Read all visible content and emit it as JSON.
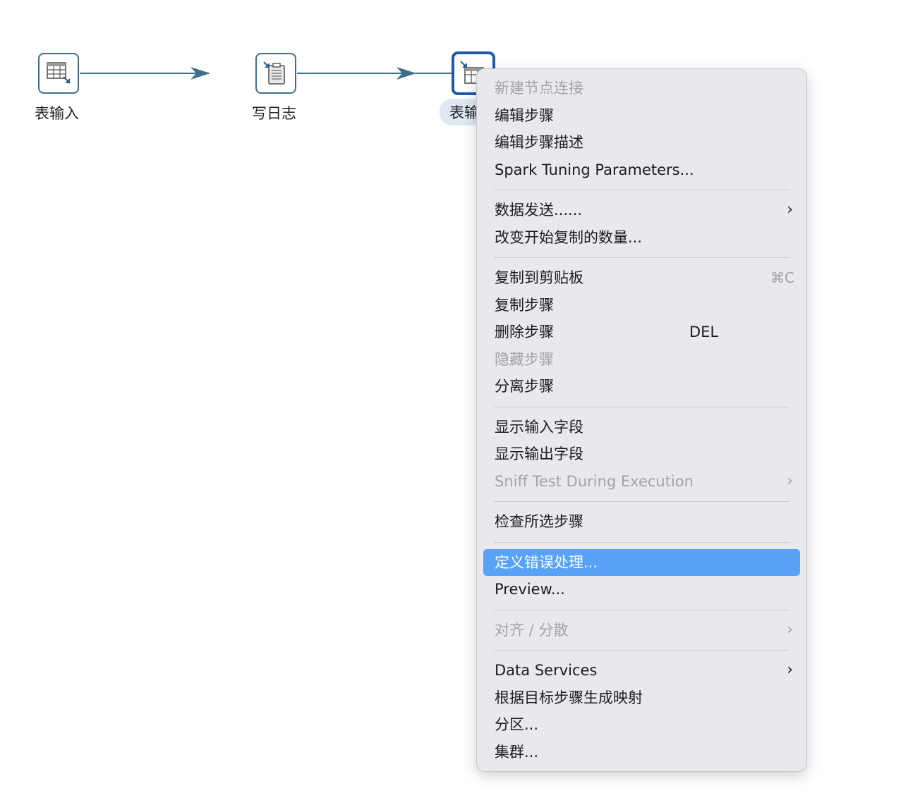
{
  "canvas": {
    "nodes": [
      {
        "label": "表输入",
        "icon": "table-input-icon",
        "selected": false
      },
      {
        "label": "写日志",
        "icon": "write-log-icon",
        "selected": false
      },
      {
        "label": "表输",
        "icon": "table-output-icon",
        "selected": true
      }
    ],
    "hop_color": "#3f6f8c"
  },
  "context_menu": {
    "groups": [
      [
        {
          "label": "新建节点连接",
          "disabled": true
        },
        {
          "label": "编辑步骤"
        },
        {
          "label": "编辑步骤描述"
        },
        {
          "label": "Spark Tuning Parameters..."
        }
      ],
      [
        {
          "label": "数据发送......",
          "submenu": true
        },
        {
          "label": "改变开始复制的数量..."
        }
      ],
      [
        {
          "label": "复制到剪贴板",
          "shortcut": "⌘C"
        },
        {
          "label": "复制步骤"
        },
        {
          "label": "删除步骤",
          "shortcut_inline": "DEL"
        },
        {
          "label": "隐藏步骤",
          "disabled": true
        },
        {
          "label": "分离步骤"
        }
      ],
      [
        {
          "label": "显示输入字段"
        },
        {
          "label": "显示输出字段"
        },
        {
          "label": "Sniff Test During Execution",
          "disabled": true,
          "submenu": true
        }
      ],
      [
        {
          "label": "检查所选步骤"
        }
      ],
      [
        {
          "label": "定义错误处理...",
          "highlighted": true
        },
        {
          "label": "Preview..."
        }
      ],
      [
        {
          "label": "对齐 / 分散",
          "disabled": true,
          "submenu": true
        }
      ],
      [
        {
          "label": "Data Services",
          "submenu": true
        },
        {
          "label": "根据目标步骤生成映射"
        },
        {
          "label": "分区..."
        },
        {
          "label": "集群..."
        }
      ]
    ],
    "chevron_glyph": "›",
    "highlight_color": "#5aa2f7"
  }
}
